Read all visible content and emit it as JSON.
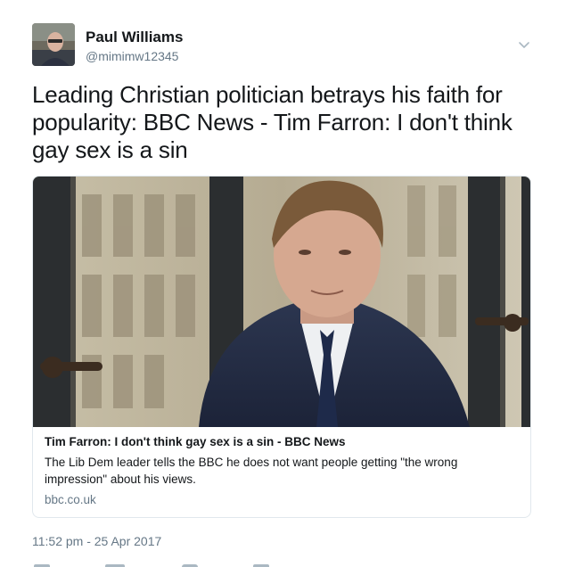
{
  "author": {
    "name": "Paul Williams",
    "handle": "@mimimw12345"
  },
  "tweet": {
    "text": "Leading Christian politician betrays his faith for popularity: BBC News - Tim Farron: I don't think gay sex is a sin",
    "timestamp": "11:52 pm - 25 Apr 2017"
  },
  "card": {
    "title": "Tim Farron: I don't think gay sex is a sin - BBC News",
    "description": "The Lib Dem leader tells the BBC he does not want people getting \"the wrong impression\" about his views.",
    "domain": "bbc.co.uk"
  },
  "icons": {
    "menu": "chevron-down-icon",
    "actions": [
      "reply-icon",
      "retweet-icon",
      "like-icon",
      "dm-icon"
    ]
  },
  "colors": {
    "text": "#14171a",
    "secondary": "#657786",
    "border": "#e1e8ed"
  }
}
